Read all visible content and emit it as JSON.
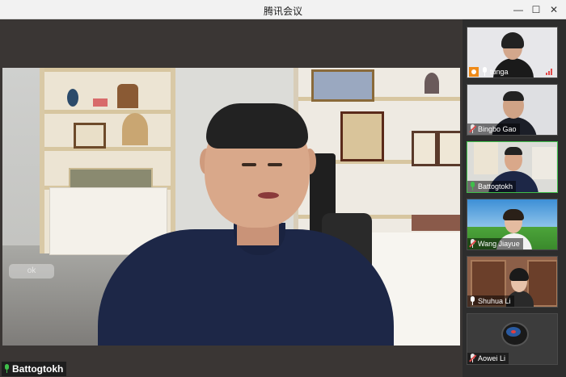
{
  "window": {
    "title": "腾讯会议",
    "minimize_glyph": "—",
    "maximize_glyph": "☐",
    "close_glyph": "✕"
  },
  "main_video": {
    "speaker_name": "Battogtokh",
    "faded_overlay_text": "ok",
    "speaker_mic_state": "speaking"
  },
  "participants": [
    {
      "name": "tunga",
      "mic": "on",
      "is_host": true,
      "signal_icon": "signal-bars-icon"
    },
    {
      "name": "Bingbo Gao",
      "mic": "muted"
    },
    {
      "name": "Battogtokh",
      "mic": "speaking"
    },
    {
      "name": "Wang Jiayue",
      "mic": "muted"
    },
    {
      "name": "Shuhua Li",
      "mic": "on"
    },
    {
      "name": "Aowei Li",
      "mic": "muted"
    }
  ],
  "colors": {
    "speaking_green": "#3fbf4a",
    "muted_red": "#e14a4a",
    "host_orange": "#ef8a18",
    "background_dark": "#2b2b2b"
  }
}
